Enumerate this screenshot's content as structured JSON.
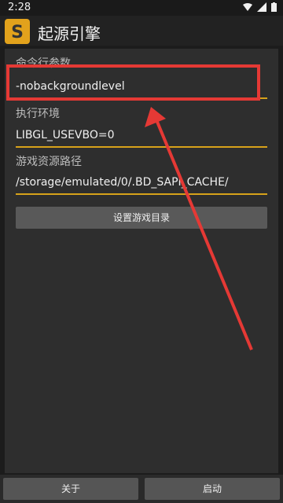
{
  "status": {
    "time": "2:28"
  },
  "app": {
    "title": "起源引擎"
  },
  "form": {
    "cmd_label": "命令行参数",
    "cmd_value": "-nobackgroundlevel",
    "env_label": "执行环境",
    "env_value": "LIBGL_USEVBO=0",
    "path_label": "游戏资源路径",
    "path_value": "/storage/emulated/0/.BD_SAPI_CACHE/",
    "set_dir_button": "设置游戏目录"
  },
  "bottom": {
    "about_button": "关于",
    "start_button": "启动"
  },
  "colors": {
    "accent": "#d7a21a",
    "annotation": "#e53935"
  }
}
